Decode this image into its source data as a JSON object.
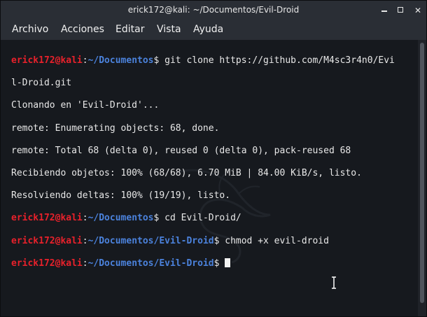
{
  "window": {
    "title": "erick172@kali: ~/Documentos/Evil-Droid"
  },
  "menu": {
    "items": [
      "Archivo",
      "Acciones",
      "Editar",
      "Vista",
      "Ayuda"
    ]
  },
  "terminal": {
    "lines": [
      {
        "user": "erick172@kali",
        "path": "~/Documentos",
        "cmd": "$ git clone https://github.com/M4sc3r4n0/Evi"
      },
      {
        "text": "l-Droid.git"
      },
      {
        "text": "Clonando en 'Evil-Droid'..."
      },
      {
        "text": "remote: Enumerating objects: 68, done."
      },
      {
        "text": "remote: Total 68 (delta 0), reused 0 (delta 0), pack-reused 68"
      },
      {
        "text": "Recibiendo objetos: 100% (68/68), 6.70 MiB | 84.00 KiB/s, listo."
      },
      {
        "text": "Resolviendo deltas: 100% (19/19), listo."
      },
      {
        "user": "erick172@kali",
        "path": "~/Documentos",
        "cmd": "$ cd Evil-Droid/"
      },
      {
        "user": "erick172@kali",
        "path": "~/Documentos/Evil-Droid",
        "cmd": "$ chmod +x evil-droid"
      },
      {
        "user": "erick172@kali",
        "path": "~/Documentos/Evil-Droid",
        "cmd": "$ "
      }
    ]
  },
  "icons": {
    "minimize": "minimize-icon",
    "maximize": "maximize-icon",
    "close": "close-icon",
    "watermark": "kali-dragon-icon",
    "pointer": "text-cursor-icon"
  },
  "colors": {
    "user": "#e8212b",
    "path": "#4b82dc",
    "text": "#e8e8e8",
    "background": "#16191e"
  }
}
